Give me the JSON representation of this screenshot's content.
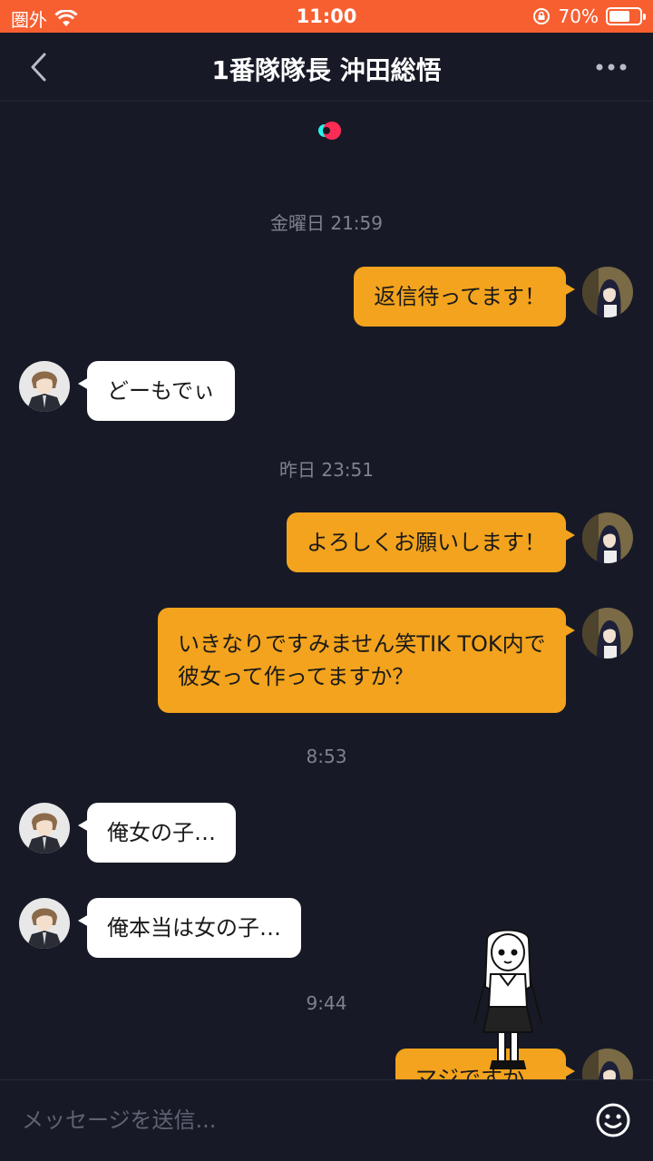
{
  "status_bar": {
    "carrier": "圏外",
    "time": "11:00",
    "battery": "70%",
    "battery_level": 0.7
  },
  "header": {
    "title": "1番隊隊長 沖田総悟"
  },
  "messages": [
    {
      "type": "timestamp",
      "text": "金曜日 21:59"
    },
    {
      "type": "out",
      "text": "返信待ってます！"
    },
    {
      "type": "in",
      "text": "どーもでぃ"
    },
    {
      "type": "timestamp",
      "text": "昨日 23:51"
    },
    {
      "type": "out",
      "text": "よろしくお願いします！"
    },
    {
      "type": "out",
      "text": "いきなりですみません笑TIK TOK内で彼女って作ってますか？"
    },
    {
      "type": "timestamp",
      "text": "8:53"
    },
    {
      "type": "in",
      "text": "俺女の子…"
    },
    {
      "type": "in",
      "text": "俺本当は女の子…"
    },
    {
      "type": "timestamp",
      "text": "9:44"
    },
    {
      "type": "out",
      "text": "マジですか…"
    }
  ],
  "input": {
    "placeholder": "メッセージを送信..."
  },
  "colors": {
    "status_bar": "#f75f31",
    "background": "#171a26",
    "outgoing_bubble": "#f3a31d",
    "incoming_bubble": "#ffffff"
  }
}
